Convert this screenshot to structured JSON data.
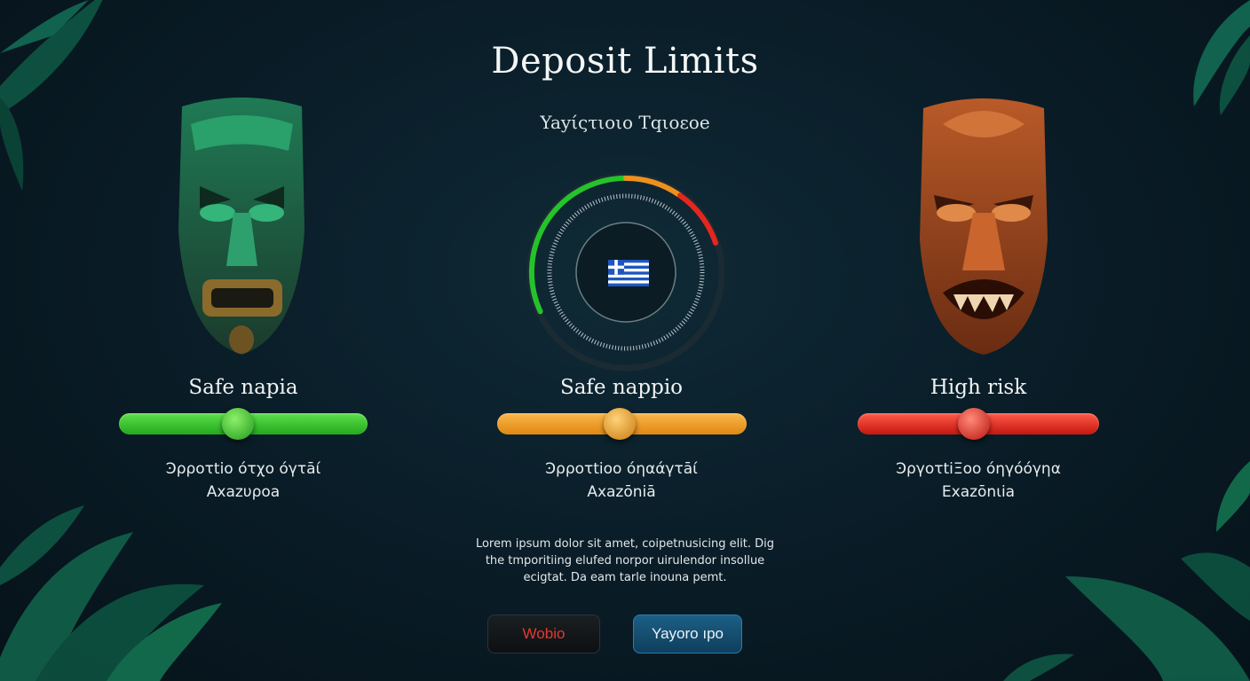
{
  "header": {
    "title": "Deposit Limits",
    "subtitle": "Yayίςτιοιο Τqιοεοe"
  },
  "gauge": {
    "icon": "greek-flag-icon",
    "segments": [
      {
        "color": "#25c22b"
      },
      {
        "color": "#f0901c"
      },
      {
        "color": "#e5261e"
      }
    ]
  },
  "tiers": [
    {
      "label": "Safe napia",
      "description_line1": "Ͽρροτtiο ότχο όγτāί",
      "description_line2": "Αxazυροa",
      "slider_value": 0.5,
      "color": "#33c42a",
      "mask_icon": "green-tiki-mask-icon"
    },
    {
      "label": "Safe nappio",
      "description_line1": "Ͽρροτtiοο όηαάγτāί",
      "description_line2": "Αxazōniā",
      "slider_value": 0.5,
      "color": "#f29a1d",
      "mask_icon": ""
    },
    {
      "label": "High risk",
      "description_line1": "ϿργοτtiΞοο όηγόόγηα",
      "description_line2": "Εxazōnιia",
      "slider_value": 0.48,
      "color": "#e8241e",
      "mask_icon": "orange-tiki-mask-icon"
    }
  ],
  "body_text": {
    "line1": "Lorem ipsum dolor sit amet, coipetnusicing elit. Dig",
    "line2": "the tmporitiing elufed norpor uirulendor insollue",
    "line3": "ecigtat. Da eam tarle inouna pemt."
  },
  "buttons": {
    "cancel_label": "Wobio",
    "confirm_label": "Yayoro ıpo"
  }
}
